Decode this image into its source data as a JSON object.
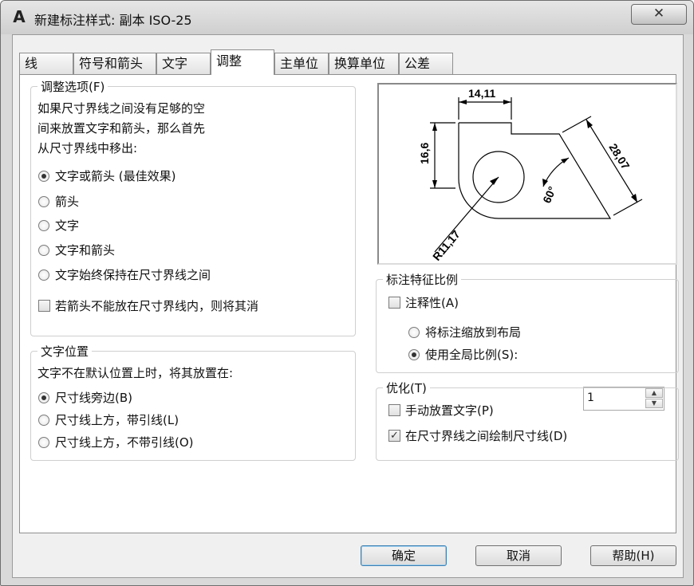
{
  "window": {
    "title": "新建标注样式: 副本 ISO-25",
    "app_icon_glyph": "A",
    "close_glyph": "✕"
  },
  "tabs": [
    {
      "label": "线"
    },
    {
      "label": "符号和箭头"
    },
    {
      "label": "文字"
    },
    {
      "label": "调整"
    },
    {
      "label": "主单位"
    },
    {
      "label": "换算单位"
    },
    {
      "label": "公差"
    }
  ],
  "active_tab": "调整",
  "fit_options": {
    "title": "调整选项(F)",
    "description": [
      "如果尺寸界线之间没有足够的空",
      "间来放置文字和箭头，那么首先",
      "从尺寸界线中移出:"
    ],
    "options": [
      {
        "label": "文字或箭头 (最佳效果)",
        "selected": true
      },
      {
        "label": "箭头",
        "selected": false
      },
      {
        "label": "文字",
        "selected": false
      },
      {
        "label": "文字和箭头",
        "selected": false
      },
      {
        "label": "文字始终保持在尺寸界线之间",
        "selected": false
      }
    ],
    "suppress_label": "若箭头不能放在尺寸界线内，则将其消",
    "suppress_checked": false
  },
  "text_placement": {
    "title": "文字位置",
    "description": "文字不在默认位置上时，将其放置在:",
    "options": [
      {
        "label": "尺寸线旁边(B)",
        "selected": true
      },
      {
        "label": "尺寸线上方，带引线(L)",
        "selected": false
      },
      {
        "label": "尺寸线上方，不带引线(O)",
        "selected": false
      }
    ]
  },
  "preview": {
    "dim_top": "14,11",
    "dim_left": "16,6",
    "dim_right": "28,07",
    "dim_angle": "60°",
    "dim_radius": "R11,17"
  },
  "scale": {
    "title": "标注特征比例",
    "annotative_label": "注释性(A)",
    "annotative_checked": false,
    "options": [
      {
        "label": "将标注缩放到布局",
        "selected": false
      },
      {
        "label": "使用全局比例(S):",
        "selected": true
      }
    ],
    "global_scale_value": "1"
  },
  "fine_tuning": {
    "title": "优化(T)",
    "options": [
      {
        "label": "手动放置文字(P)",
        "checked": false
      },
      {
        "label": "在尺寸界线之间绘制尺寸线(D)",
        "checked": true
      }
    ]
  },
  "buttons": {
    "ok": "确定",
    "cancel": "取消",
    "help": "帮助(H)"
  }
}
